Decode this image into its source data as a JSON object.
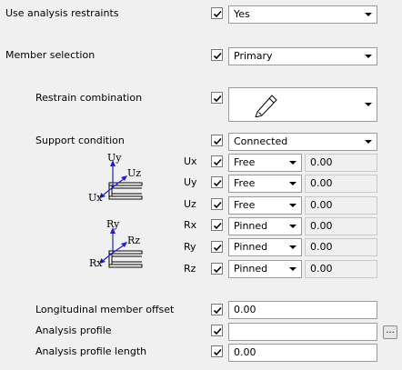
{
  "use_analysis_restraints": {
    "label": "Use analysis restraints",
    "checked": true,
    "value": "Yes"
  },
  "member_selection": {
    "label": "Member selection",
    "checked": true,
    "value": "Primary"
  },
  "restrain_combination": {
    "label": "Restrain combination",
    "checked": true,
    "icon": "pencil-icon"
  },
  "support_condition": {
    "label": "Support condition",
    "checked": true,
    "value": "Connected",
    "diagram_top": {
      "y": "Uy",
      "z": "Uz",
      "x": "Ux"
    },
    "diagram_bottom": {
      "y": "Ry",
      "z": "Rz",
      "x": "Rx"
    },
    "rows": [
      {
        "name": "Ux",
        "checked": true,
        "value": "Free",
        "number": "0.00"
      },
      {
        "name": "Uy",
        "checked": true,
        "value": "Free",
        "number": "0.00"
      },
      {
        "name": "Uz",
        "checked": true,
        "value": "Free",
        "number": "0.00"
      },
      {
        "name": "Rx",
        "checked": true,
        "value": "Pinned",
        "number": "0.00"
      },
      {
        "name": "Ry",
        "checked": true,
        "value": "Pinned",
        "number": "0.00"
      },
      {
        "name": "Rz",
        "checked": true,
        "value": "Pinned",
        "number": "0.00"
      }
    ]
  },
  "longitudinal_member_offset": {
    "label": "Longitudinal member offset",
    "checked": true,
    "value": "0.00"
  },
  "analysis_profile": {
    "label": "Analysis profile",
    "checked": true,
    "value": "",
    "button": "..."
  },
  "analysis_profile_length": {
    "label": "Analysis profile length",
    "checked": true,
    "value": "0.00"
  },
  "colors": {
    "axis_arrow": "#1f1fd0",
    "check": "#000000",
    "field_border": "#9a9a9a"
  }
}
